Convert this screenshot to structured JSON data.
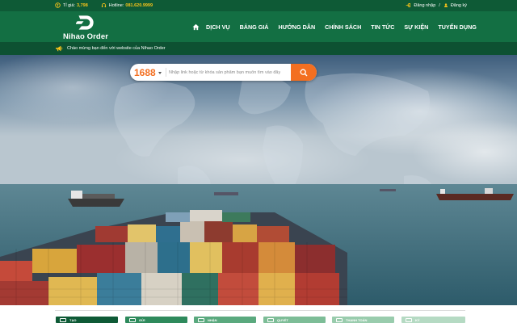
{
  "topbar": {
    "rate_label": "Tỉ giá:",
    "rate_value": "3,798",
    "hotline_label": "Hotline:",
    "hotline_value": "081.620.9999",
    "login": "Đăng nhập",
    "separator": "/",
    "register": "Đăng ký"
  },
  "brand": {
    "name": "Nihao Order"
  },
  "nav": {
    "items": [
      "DỊCH VỤ",
      "BẢNG GIÁ",
      "HƯỚNG DẪN",
      "CHÍNH SÁCH",
      "TIN TỨC",
      "SỰ KIỆN",
      "TUYỂN DỤNG"
    ]
  },
  "announcement": {
    "text": "Chào mừng bạn đến với website của Nihao Order"
  },
  "search": {
    "site": "1688",
    "placeholder": "Nhập link hoặc từ khóa sản phẩm bạn muốn tìm vào đây..."
  },
  "services": {
    "items": [
      "TẠO",
      "GỬI",
      "NHẬN",
      "QUYẾT",
      "THANH TOÁN",
      "KÝ"
    ]
  },
  "colors": {
    "header_green": "#136f43",
    "topbar_green": "#0e5a36",
    "accent_orange": "#f36f21",
    "highlight_yellow": "#f6c21a"
  },
  "icons": [
    "coin-icon",
    "headset-icon",
    "login-icon",
    "user-icon",
    "home-icon",
    "megaphone-icon",
    "search-icon",
    "caret-down-icon"
  ]
}
